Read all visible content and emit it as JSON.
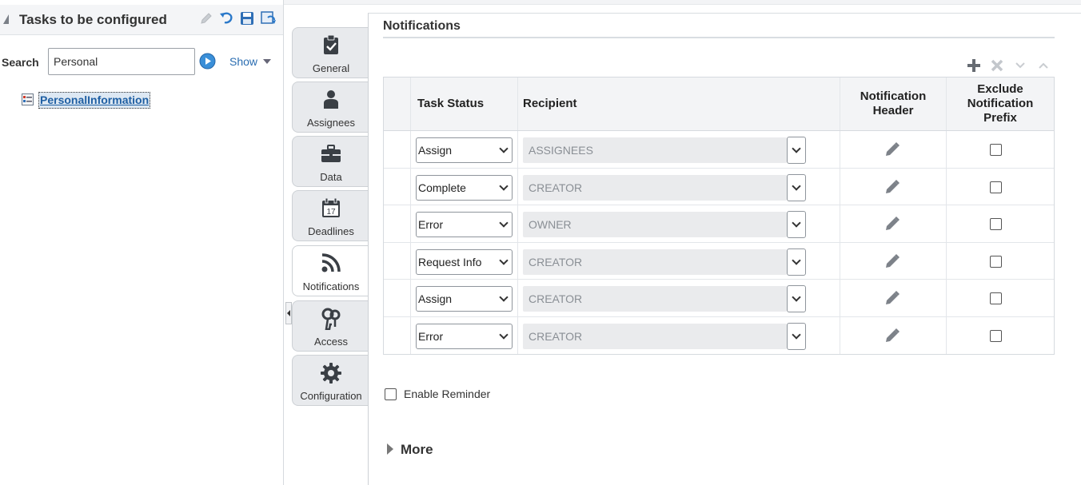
{
  "left_panel": {
    "title": "Tasks to be configured",
    "toolbar_icons": [
      "edit-icon",
      "undo-icon",
      "save-icon",
      "refresh-icon"
    ],
    "search": {
      "label": "Search",
      "value": "Personal",
      "go_icon": "go-icon",
      "show_label": "Show"
    },
    "tree": [
      {
        "label": "PersonalInformation",
        "icon": "task-icon",
        "selected": true
      }
    ]
  },
  "tabs": [
    {
      "label": "General",
      "icon": "clipboard-check-icon",
      "active": false
    },
    {
      "label": "Assignees",
      "icon": "person-icon",
      "active": false
    },
    {
      "label": "Data",
      "icon": "briefcase-icon",
      "active": false
    },
    {
      "label": "Deadlines",
      "icon": "calendar-icon",
      "active": false,
      "icon_text": "17"
    },
    {
      "label": "Notifications",
      "icon": "rss-icon",
      "active": true
    },
    {
      "label": "Access",
      "icon": "keys-icon",
      "active": false
    },
    {
      "label": "Configuration",
      "icon": "gear-icon",
      "active": false
    }
  ],
  "main": {
    "title": "Notifications",
    "toolbar": [
      "add-icon",
      "delete-icon",
      "move-down-icon",
      "move-up-icon"
    ],
    "table": {
      "headers": {
        "task_status": "Task Status",
        "recipient": "Recipient",
        "notification_header_1": "Notification",
        "notification_header_2": "Header",
        "exclude_1": "Exclude",
        "exclude_2": "Notification",
        "exclude_3": "Prefix"
      },
      "rows": [
        {
          "task_status": "Assign",
          "recipient": "ASSIGNEES",
          "exclude_prefix": false
        },
        {
          "task_status": "Complete",
          "recipient": "CREATOR",
          "exclude_prefix": false
        },
        {
          "task_status": "Error",
          "recipient": "OWNER",
          "exclude_prefix": false
        },
        {
          "task_status": "Request Info",
          "recipient": "CREATOR",
          "exclude_prefix": false
        },
        {
          "task_status": "Assign",
          "recipient": "CREATOR",
          "exclude_prefix": false
        },
        {
          "task_status": "Error",
          "recipient": "CREATOR",
          "exclude_prefix": false
        }
      ]
    },
    "enable_reminder": {
      "label": "Enable Reminder",
      "checked": false
    },
    "more": {
      "label": "More"
    }
  },
  "colors": {
    "link": "#2a6db1",
    "tab_bg": "#e8eaed",
    "header_bg": "#f3f4f6",
    "readonly_bg": "#eaebed"
  }
}
